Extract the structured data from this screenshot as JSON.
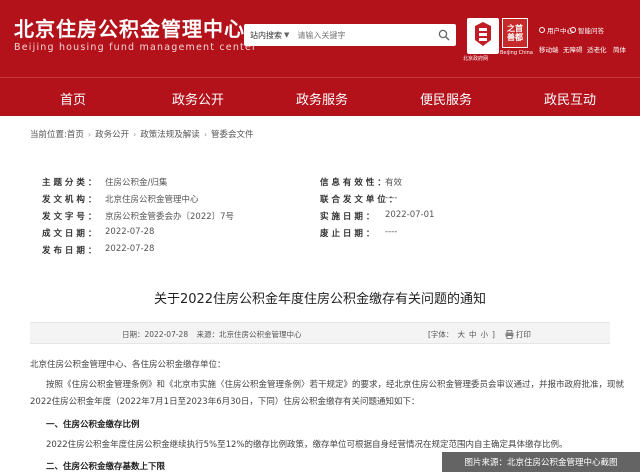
{
  "header": {
    "site_title": "北京住房公积金管理中心",
    "site_subtitle": "Beijing housing fund management center",
    "search": {
      "scope": "站内搜索",
      "placeholder": "请输入关键字"
    },
    "logos": {
      "a_caption": "北京政府网",
      "b_text_1": "之首",
      "b_text_2": "善都",
      "b_caption": "Beijing China"
    },
    "utilities": [
      "用户中心",
      "智能问答",
      "移动端",
      "无障碍",
      "适老化",
      "简体"
    ]
  },
  "nav": {
    "items": [
      "首页",
      "政务公开",
      "政务服务",
      "便民服务",
      "政民互动"
    ]
  },
  "breadcrumb": {
    "prefix": "当前位置:首页",
    "items": [
      "政务公开",
      "政策法规及解读",
      "管委会文件"
    ]
  },
  "info": {
    "rows": [
      {
        "l_label": "主 题 分 类 ：",
        "l_value": "住房公积金/归集",
        "r_label": "信 息 有 效 性 ：",
        "r_value": "有效"
      },
      {
        "l_label": "发 文 机 构 ：",
        "l_value": "北京住房公积金管理中心",
        "r_label": "联 合 发 文 单 位 ：",
        "r_value": "----"
      },
      {
        "l_label": "发 文 字 号 ：",
        "l_value": "京房公积金管委会办〔2022〕7号",
        "r_label": "实 施 日 期 ：",
        "r_value": "2022-07-01"
      },
      {
        "l_label": "成 文 日 期 ：",
        "l_value": "2022-07-28",
        "r_label": "废 止 日 期 ：",
        "r_value": "----"
      },
      {
        "l_label": "发 布 日 期 ：",
        "l_value": "2022-07-28",
        "r_label": "",
        "r_value": ""
      }
    ]
  },
  "document": {
    "title": "关于2022住房公积金年度住房公积金缴存有关问题的通知",
    "meta_date": "日期：2022-07-28",
    "meta_source": "来源：北京住房公积金管理中心",
    "font_label": "[字体：",
    "font_sizes": [
      "大",
      "中",
      "小"
    ],
    "font_end": "]",
    "print_label": "打印",
    "para_1": "北京住房公积金管理中心、各住房公积金缴存单位：",
    "para_2_line1": "按照《住房公积金管理条例》和《北京市实施〈住房公积金管理条例〉若干规定》的要求，经北京住房公积金管理委员会审议通过，并报市政府批准，现就",
    "para_2_line2": "2022住房公积金年度（2022年7月1日至2023年6月30日，下同）住房公积金缴存有关问题通知如下：",
    "section_1": "一、住房公积金缴存比例",
    "para_3": "2022住房公积金年度住房公积金继续执行5%至12%的缴存比例政策，缴存单位可根据自身经营情况在规定范围内自主确定具体缴存比例。",
    "section_2": "二、住房公积金缴存基数上下限"
  },
  "watermark": "图片来源：北京住房公积金管理中心截图"
}
